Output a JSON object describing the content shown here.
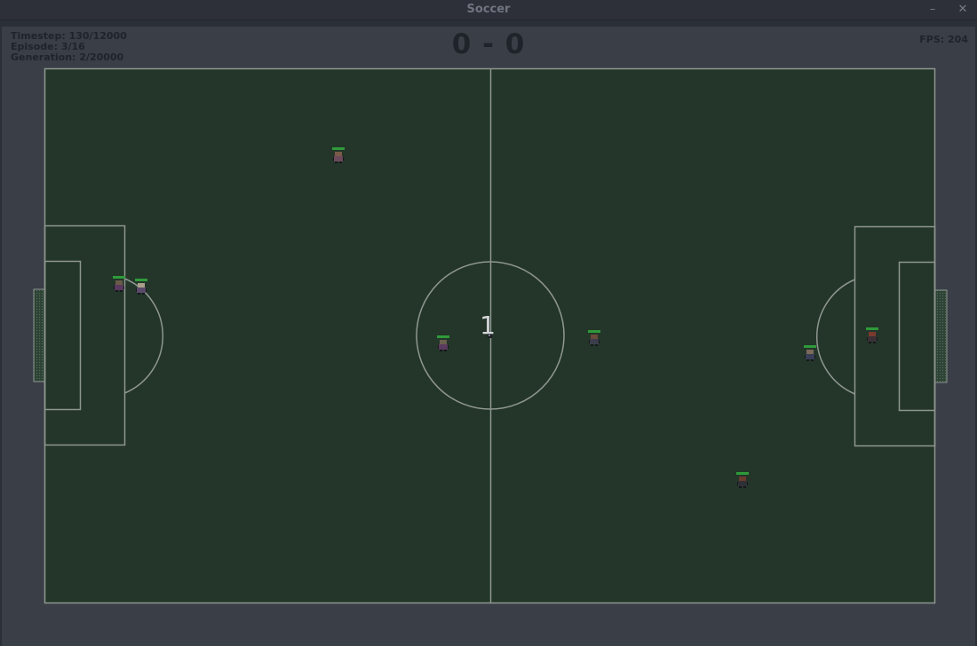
{
  "window": {
    "title": "Soccer",
    "minimize_glyph": "–",
    "close_glyph": "✕"
  },
  "hud": {
    "timestep": "Timestep: 130/12000",
    "episode": "Episode: 3/16",
    "generation": "Generation: 2/20000",
    "score": "0 - 0",
    "fps": "FPS: 204"
  },
  "ball": {
    "label": "1"
  },
  "colors": {
    "pitch": "#233629",
    "lines": "#8f9690",
    "health": "#2f9a3a"
  },
  "players": [
    {
      "name": "player-left-1",
      "shirt": "#6a4a5a",
      "head": "#7a5a48"
    },
    {
      "name": "player-left-2",
      "shirt": "#5a4a6a",
      "head": "#a8a08a"
    },
    {
      "name": "player-left-3",
      "shirt": "#5a3a5e",
      "head": "#6a5a4a"
    },
    {
      "name": "player-left-4",
      "shirt": "#5a3a5e",
      "head": "#6a6050"
    },
    {
      "name": "player-right-1",
      "shirt": "#3a3e4a",
      "head": "#6a4a3a"
    },
    {
      "name": "player-right-2",
      "shirt": "#3a3e55",
      "head": "#7a6a5a"
    },
    {
      "name": "player-right-3",
      "shirt": "#3a3035",
      "head": "#7a3a2e"
    },
    {
      "name": "player-right-4",
      "shirt": "#2f3035",
      "head": "#6a3a2e"
    }
  ]
}
